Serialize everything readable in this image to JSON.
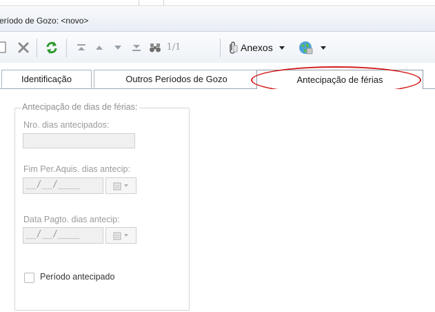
{
  "window": {
    "title": "eríodo de Gozo: <novo>"
  },
  "toolbar": {
    "pager_text": "1/1",
    "anexos_label": "Anexos",
    "icons": [
      "new-doc-icon",
      "delete-icon",
      "refresh-icon",
      "first-record-icon",
      "previous-record-icon",
      "next-record-icon",
      "last-record-icon",
      "binoculars-icon",
      "paperclip-icon",
      "dropdown-arrow-icon",
      "globe-icon",
      "dropdown-arrow-icon"
    ]
  },
  "tabs": [
    {
      "label": "Identificação",
      "active": false
    },
    {
      "label": "Outros Períodos de Gozo",
      "active": false
    },
    {
      "label": "Antecipação de férias",
      "active": true
    }
  ],
  "form": {
    "group_legend": "Antecipação de dias de férias:",
    "nro_dias": {
      "label": "Nro. dias antecipados:",
      "value": ""
    },
    "fim_per": {
      "label": "Fim Per.Aquis. dias antecip:",
      "value": "__/__/____"
    },
    "data_pagto": {
      "label": "Data Pagto. dias antecip:",
      "value": "__/__/____"
    },
    "periodo_antecipado": {
      "label": "Período antecipado",
      "checked": false
    }
  },
  "colors": {
    "highlight": "#d21d1d",
    "refresh_green": "#2d9a2d",
    "disabled_text": "#9a9a9a"
  }
}
